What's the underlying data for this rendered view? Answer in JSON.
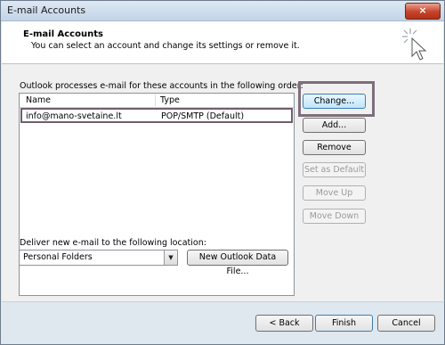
{
  "window": {
    "title": "E-mail Accounts",
    "close_label": "×"
  },
  "header": {
    "title": "E-mail Accounts",
    "subtitle": "You can select an account and change its settings or remove it."
  },
  "accounts": {
    "intro": "Outlook processes e-mail for these accounts in the following order:",
    "columns": [
      "Name",
      "Type"
    ],
    "rows": [
      {
        "name": "info@mano-svetaine.lt",
        "type": "POP/SMTP (Default)"
      }
    ]
  },
  "buttons": {
    "change": "Change...",
    "add": "Add...",
    "remove": "Remove",
    "set_default": "Set as Default",
    "move_up": "Move Up",
    "move_down": "Move Down"
  },
  "deliver": {
    "label": "Deliver new e-mail to the following location:",
    "selected": "Personal Folders",
    "new_file_button": "New Outlook Data File..."
  },
  "footer": {
    "back": "< Back",
    "finish": "Finish",
    "cancel": "Cancel"
  },
  "icons": {
    "header": "cursor-sparkle-icon",
    "dropdown": "chevron-down-icon"
  }
}
